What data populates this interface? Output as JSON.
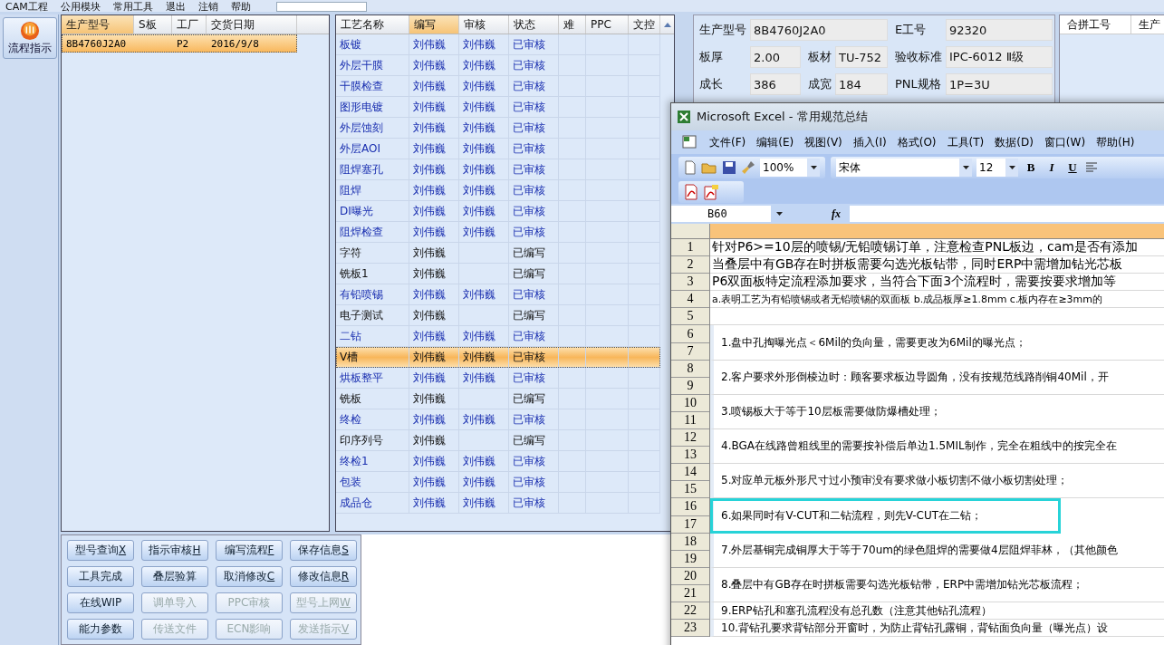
{
  "menu_bar": {
    "items": [
      "CAM工程",
      "公用模块",
      "常用工具",
      "退出",
      "注销",
      "帮助"
    ]
  },
  "sidebar": {
    "button": "流程指示"
  },
  "orders_table": {
    "columns": [
      "生产型号",
      "S板",
      "工厂",
      "交货日期"
    ],
    "rows": [
      {
        "cells": [
          "8B4760J2A0",
          "",
          "P2",
          "2016/9/8"
        ],
        "selected": true
      }
    ]
  },
  "process_table": {
    "columns": [
      "工艺名称",
      "编写",
      "审核",
      "状态",
      "难",
      "PPC",
      "文控"
    ],
    "rows": [
      {
        "name": "板镀",
        "writer": "刘伟巍",
        "reviewer": "刘伟巍",
        "status": "已审核",
        "reviewed": true,
        "selected": false
      },
      {
        "name": "外层干膜",
        "writer": "刘伟巍",
        "reviewer": "刘伟巍",
        "status": "已审核",
        "reviewed": true,
        "selected": false
      },
      {
        "name": "干膜检查",
        "writer": "刘伟巍",
        "reviewer": "刘伟巍",
        "status": "已审核",
        "reviewed": true,
        "selected": false
      },
      {
        "name": "图形电镀",
        "writer": "刘伟巍",
        "reviewer": "刘伟巍",
        "status": "已审核",
        "reviewed": true,
        "selected": false
      },
      {
        "name": "外层蚀刻",
        "writer": "刘伟巍",
        "reviewer": "刘伟巍",
        "status": "已审核",
        "reviewed": true,
        "selected": false
      },
      {
        "name": "外层AOI",
        "writer": "刘伟巍",
        "reviewer": "刘伟巍",
        "status": "已审核",
        "reviewed": true,
        "selected": false
      },
      {
        "name": "阻焊塞孔",
        "writer": "刘伟巍",
        "reviewer": "刘伟巍",
        "status": "已审核",
        "reviewed": true,
        "selected": false
      },
      {
        "name": "阻焊",
        "writer": "刘伟巍",
        "reviewer": "刘伟巍",
        "status": "已审核",
        "reviewed": true,
        "selected": false
      },
      {
        "name": "DI曝光",
        "writer": "刘伟巍",
        "reviewer": "刘伟巍",
        "status": "已审核",
        "reviewed": true,
        "selected": false
      },
      {
        "name": "阻焊检查",
        "writer": "刘伟巍",
        "reviewer": "刘伟巍",
        "status": "已审核",
        "reviewed": true,
        "selected": false
      },
      {
        "name": "字符",
        "writer": "刘伟巍",
        "status": "已编写",
        "reviewed": false,
        "selected": false
      },
      {
        "name": "铣板1",
        "writer": "刘伟巍",
        "status": "已编写",
        "reviewed": false,
        "selected": false
      },
      {
        "name": "有铅喷锡",
        "writer": "刘伟巍",
        "reviewer": "刘伟巍",
        "status": "已审核",
        "reviewed": true,
        "selected": false
      },
      {
        "name": "电子测试",
        "writer": "刘伟巍",
        "status": "已编写",
        "reviewed": false,
        "selected": false
      },
      {
        "name": "二钻",
        "writer": "刘伟巍",
        "reviewer": "刘伟巍",
        "status": "已审核",
        "reviewed": true,
        "selected": false
      },
      {
        "name": "V槽",
        "writer": "刘伟巍",
        "reviewer": "刘伟巍",
        "status": "已审核",
        "reviewed": true,
        "selected": true
      },
      {
        "name": "烘板整平",
        "writer": "刘伟巍",
        "reviewer": "刘伟巍",
        "status": "已审核",
        "reviewed": true,
        "selected": false
      },
      {
        "name": "铣板",
        "writer": "刘伟巍",
        "status": "已编写",
        "reviewed": false,
        "selected": false
      },
      {
        "name": "终检",
        "writer": "刘伟巍",
        "reviewer": "刘伟巍",
        "status": "已审核",
        "reviewed": true,
        "selected": false
      },
      {
        "name": "印序列号",
        "writer": "刘伟巍",
        "status": "已编写",
        "reviewed": false,
        "selected": false
      },
      {
        "name": "终检1",
        "writer": "刘伟巍",
        "reviewer": "刘伟巍",
        "status": "已审核",
        "reviewed": true,
        "selected": false
      },
      {
        "name": "包装",
        "writer": "刘伟巍",
        "reviewer": "刘伟巍",
        "status": "已审核",
        "reviewed": true,
        "selected": false
      },
      {
        "name": "成品仓",
        "writer": "刘伟巍",
        "reviewer": "刘伟巍",
        "status": "已审核",
        "reviewed": true,
        "selected": false
      }
    ]
  },
  "info_form": {
    "fields": [
      {
        "label": "生产型号",
        "value": "8B4760J2A0"
      },
      {
        "label": "E工号",
        "value": "92320"
      },
      {
        "label": "板厚",
        "value": "2.00"
      },
      {
        "label": "板材",
        "value": "TU-752"
      },
      {
        "label": "验收标准",
        "value": "IPC-6012 Ⅱ级"
      },
      {
        "label": "成长",
        "value": "386"
      },
      {
        "label": "成宽",
        "value": "184"
      },
      {
        "label": "PNL规格",
        "value": "1P=3U"
      }
    ]
  },
  "merge_table": {
    "columns": [
      "合拼工号",
      "生产"
    ]
  },
  "action_buttons": [
    {
      "label": "型号查询",
      "shortcut": "X",
      "disabled": false
    },
    {
      "label": "指示审核",
      "shortcut": "H",
      "disabled": false
    },
    {
      "label": "编写流程",
      "shortcut": "F",
      "disabled": false
    },
    {
      "label": "保存信息",
      "shortcut": "S",
      "disabled": false
    },
    {
      "label": "工具完成",
      "disabled": false
    },
    {
      "label": "叠层验算",
      "disabled": false
    },
    {
      "label": "取消修改",
      "shortcut": "C",
      "disabled": false
    },
    {
      "label": "修改信息",
      "shortcut": "R",
      "disabled": false
    },
    {
      "label": "在线WIP",
      "disabled": false
    },
    {
      "label": "调单导入",
      "disabled": true
    },
    {
      "label": "PPC审核",
      "disabled": true
    },
    {
      "label": "型号上网",
      "shortcut": "W",
      "disabled": true
    },
    {
      "label": "能力参数",
      "disabled": false
    },
    {
      "label": "传送文件",
      "disabled": true
    },
    {
      "label": "ECN影响",
      "disabled": true
    },
    {
      "label": "发送指示",
      "shortcut": "V",
      "disabled": true
    }
  ],
  "excel_window": {
    "title": "Microsoft Excel - 常用规范总结",
    "menu": [
      "文件(F)",
      "编辑(E)",
      "视图(V)",
      "插入(I)",
      "格式(O)",
      "工具(T)",
      "数据(D)",
      "窗口(W)",
      "帮助(H)"
    ],
    "zoom": "100%",
    "font": "宋体",
    "font_size": "12",
    "format_buttons": [
      "B",
      "I",
      "U"
    ],
    "name_box": "B60",
    "formula_label": "fx",
    "lines": [
      {
        "rows": [
          "1"
        ],
        "text": "针对P6>=10层的喷锡/无铅喷锡订单，注意检查PNL板边，cam是否有添加",
        "kind": "header",
        "highlighted": false
      },
      {
        "rows": [
          "2"
        ],
        "text": "当叠层中有GB存在时拼板需要勾选光板钻带，同时ERP中需增加钻光芯板",
        "kind": "header",
        "highlighted": false
      },
      {
        "rows": [
          "3"
        ],
        "text": "P6双面板特定流程添加要求，当符合下面3个流程时，需要按要求增加等",
        "kind": "header",
        "highlighted": false
      },
      {
        "rows": [
          "4"
        ],
        "text": "a.表明工艺为有铅喷锡或者无铅喷锡的双面板 b.成品板厚≥1.8mm c.板内存在≥3mm的",
        "kind": "note",
        "highlighted": false
      },
      {
        "rows": [
          "5"
        ],
        "kind": "blank",
        "highlighted": false
      },
      {
        "rows": [
          "6",
          "7"
        ],
        "text": "1.盘中孔掏曝光点＜6Mil的负向量，需要更改为6Mil的曝光点；",
        "kind": "item",
        "highlighted": false
      },
      {
        "rows": [
          "8",
          "9"
        ],
        "text": "2.客户要求外形倒棱边时：顾客要求板边导圆角，没有按规范线路削铜40Mil，开",
        "kind": "item",
        "highlighted": false
      },
      {
        "rows": [
          "10",
          "11"
        ],
        "text": "3.喷锡板大于等于10层板需要做防爆槽处理；",
        "kind": "item",
        "highlighted": false
      },
      {
        "rows": [
          "12",
          "13"
        ],
        "text": "4.BGA在线路曾粗线里的需要按补偿后单边1.5MIL制作，完全在粗线中的按完全在",
        "kind": "item",
        "highlighted": false
      },
      {
        "rows": [
          "14",
          "15"
        ],
        "text": "5.对应单元板外形尺寸过小预审没有要求做小板切割不做小板切割处理；",
        "kind": "item",
        "highlighted": false
      },
      {
        "rows": [
          "16",
          "17"
        ],
        "text": "6.如果同时有V-CUT和二钻流程，则先V-CUT在二钻；",
        "kind": "item",
        "highlighted": true
      },
      {
        "rows": [
          "18",
          "19"
        ],
        "text": "7.外层基铜完成铜厚大于等于70um的绿色阻焊的需要做4层阻焊菲林，（其他颜色",
        "kind": "item",
        "highlighted": false
      },
      {
        "rows": [
          "20",
          "21"
        ],
        "text": "8.叠层中有GB存在时拼板需要勾选光板钻带，ERP中需增加钻光芯板流程；",
        "kind": "item",
        "highlighted": false
      },
      {
        "rows": [
          "22"
        ],
        "text": "9.ERP钻孔和塞孔流程没有总孔数（注意其他钻孔流程）",
        "kind": "item",
        "highlighted": false
      },
      {
        "rows": [
          "23"
        ],
        "text": "10.背钻孔要求背钻部分开窗时，为防止背钻孔露铜，背钻面负向量（曝光点）设",
        "kind": "item",
        "highlighted": false
      }
    ]
  }
}
